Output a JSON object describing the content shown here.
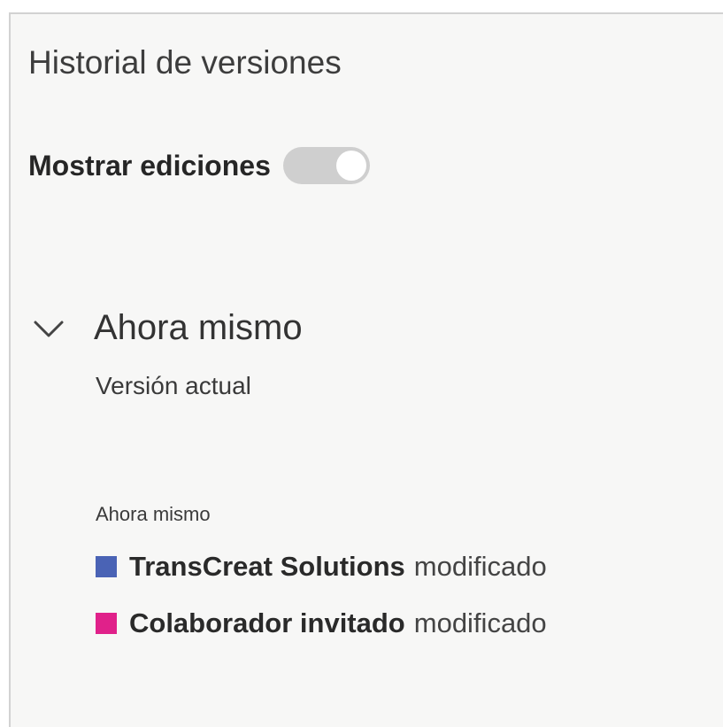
{
  "panel": {
    "title": "Historial de versiones",
    "show_edits": {
      "label": "Mostrar ediciones",
      "state": "off"
    },
    "group": {
      "title": "Ahora mismo",
      "expanded": true,
      "icon": "chevron-down-icon",
      "subtitle": "Versión actual",
      "entry": {
        "time": "Ahora mismo",
        "editors": [
          {
            "name": "TransCreat Solutions",
            "action": "modificado",
            "color": "#4a63b5"
          },
          {
            "name": "Colaborador invitado",
            "action": "modificado",
            "color": "#e0218a"
          }
        ]
      }
    }
  }
}
